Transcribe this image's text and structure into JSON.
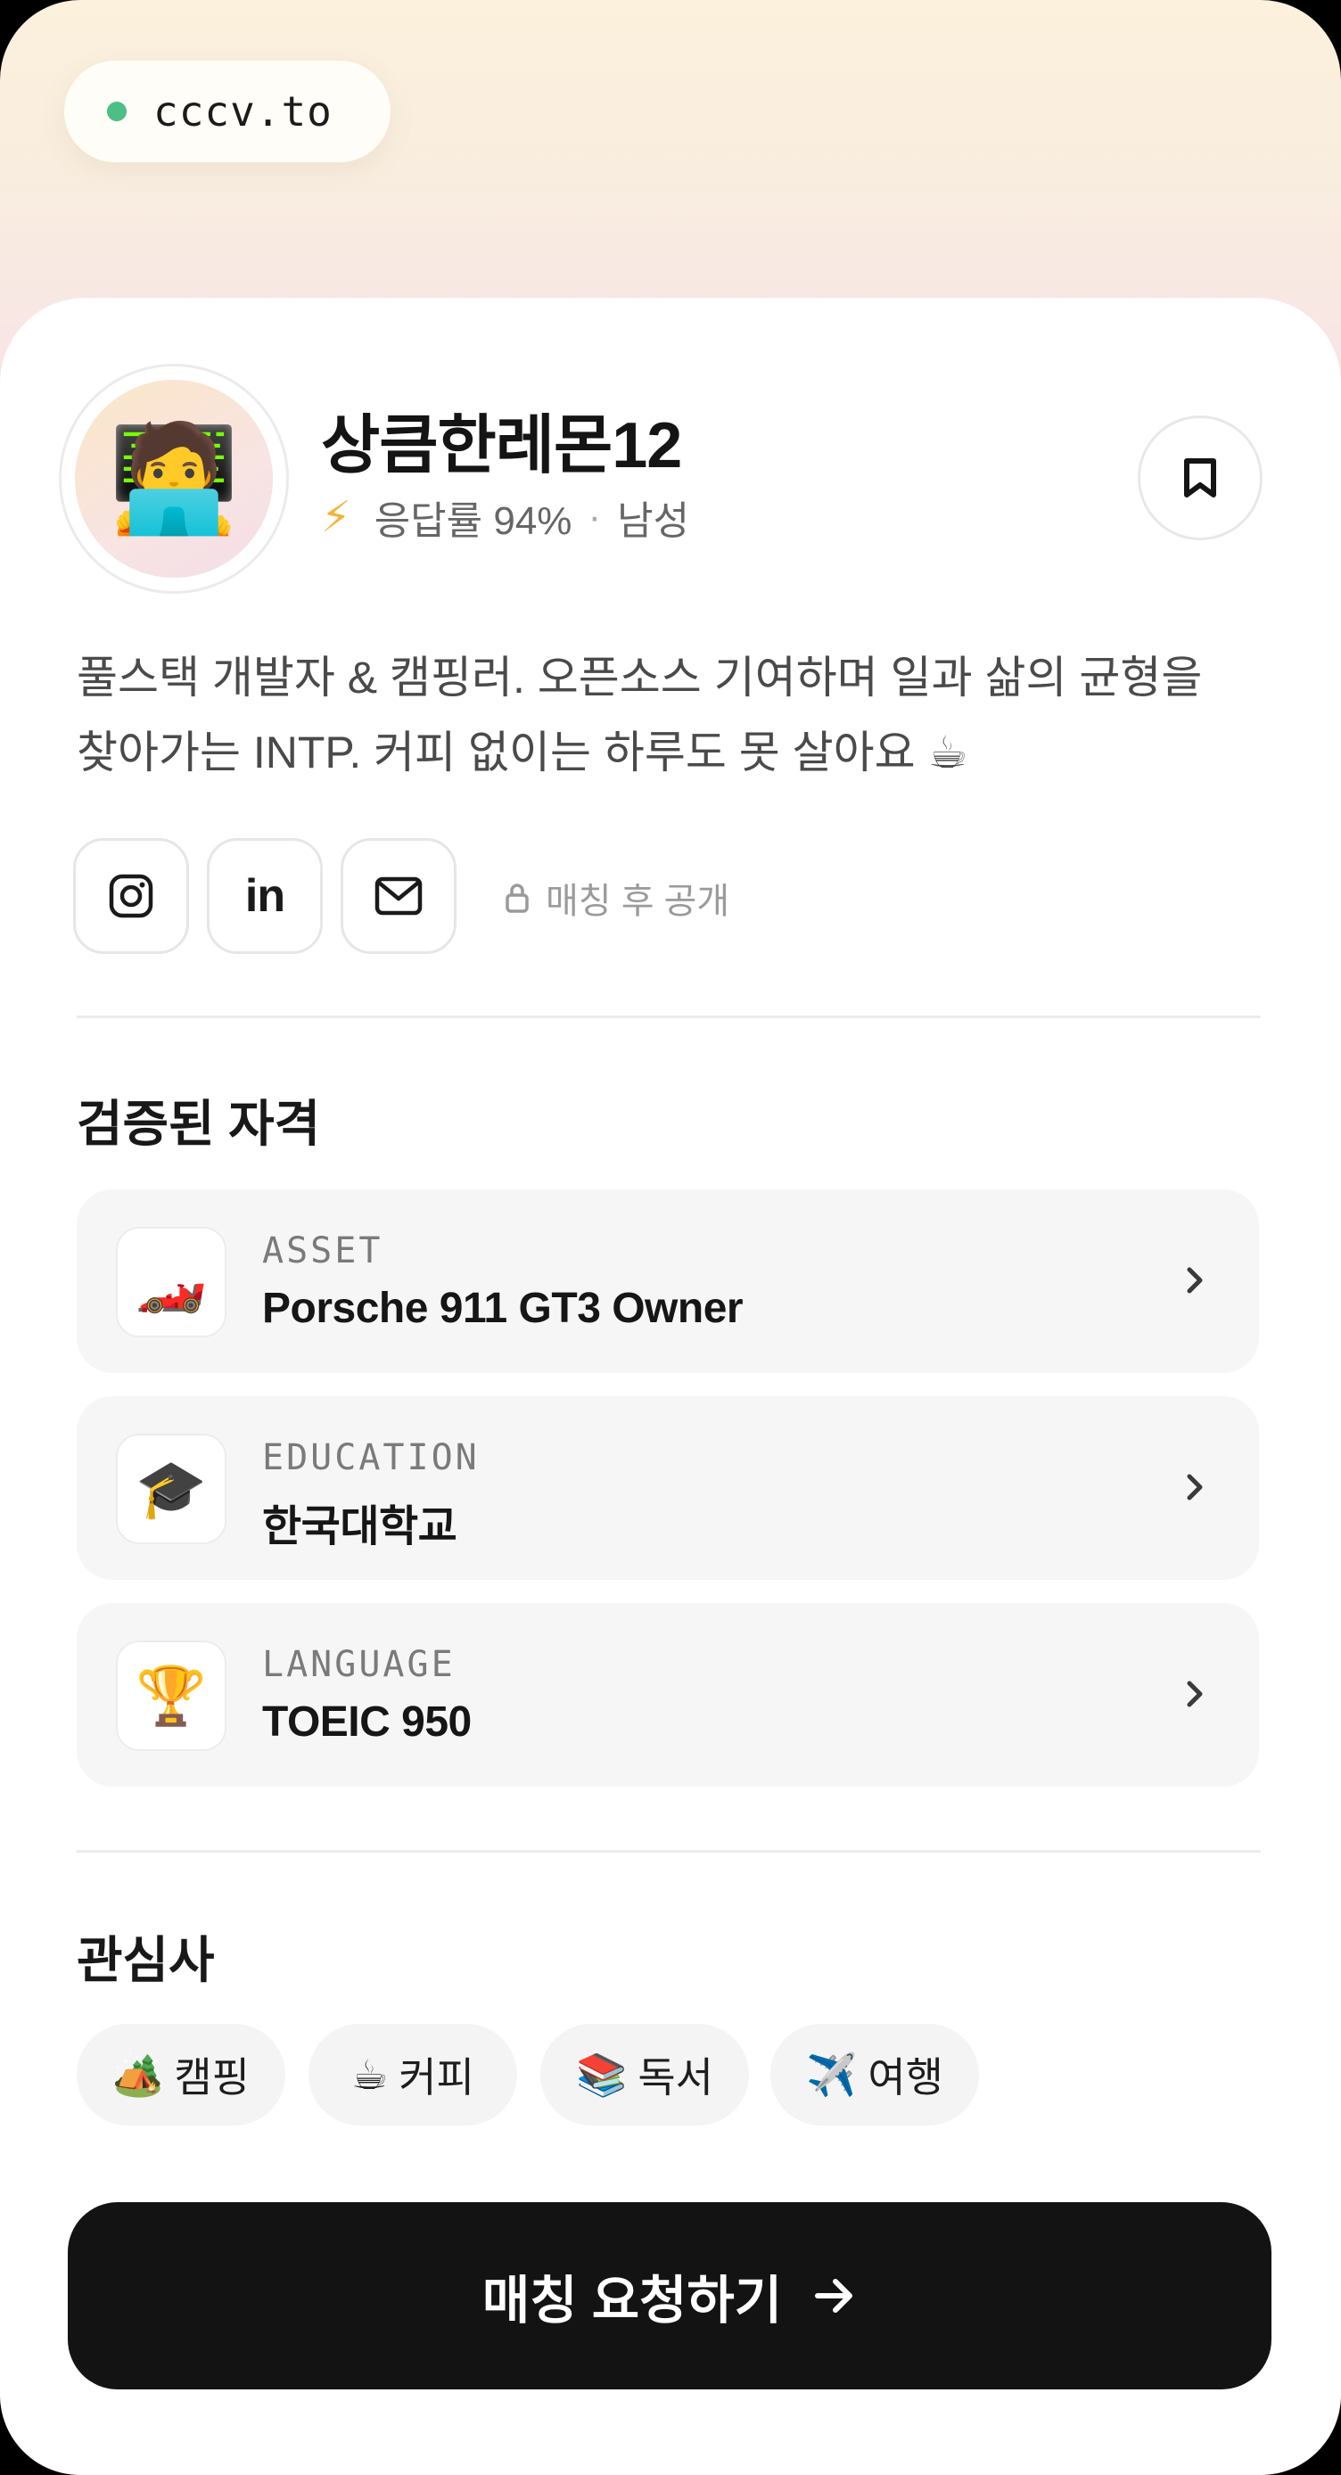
{
  "browser": {
    "url": "cccv.to",
    "status_color": "#4cbf84"
  },
  "profile": {
    "avatar_emoji": "🧑‍💻",
    "name": "상큼한레몬12",
    "response_icon": "⚡",
    "response_rate": "응답률 94%",
    "separator": "·",
    "gender": "남성",
    "bookmark_icon": "bookmark-icon",
    "bio_line1": "풀스택 개발자 & 캠핑러. 오픈소스 기여하며 일과 삶의 균형을",
    "bio_line2": "찾아가는 INTP. 커피 없이는 하루도 못 살아요 ☕"
  },
  "social": {
    "buttons": [
      "instagram-icon",
      "linkedin-icon",
      "mail-icon"
    ],
    "linkedin_text": "in",
    "locked_label": "매칭 후 공개"
  },
  "credentials": {
    "title": "검증된 자격",
    "items": [
      {
        "emoji": "🏎️",
        "category": "ASSET",
        "title": "Porsche 911 GT3 Owner"
      },
      {
        "emoji": "🎓",
        "category": "EDUCATION",
        "title": "한국대학교"
      },
      {
        "emoji": "🏆",
        "category": "LANGUAGE",
        "title": "TOEIC 950"
      }
    ]
  },
  "interests": {
    "title": "관심사",
    "chips": [
      {
        "emoji": "🏕️",
        "label": "캠핑"
      },
      {
        "emoji": "☕",
        "label": "커피"
      },
      {
        "emoji": "📚",
        "label": "독서"
      },
      {
        "emoji": "✈️",
        "label": "여행"
      }
    ]
  },
  "cta": {
    "label": "매칭 요청하기"
  },
  "colors": {
    "accent_dark": "#131313",
    "card": "#ffffff",
    "chip": "#f4f4f4"
  }
}
